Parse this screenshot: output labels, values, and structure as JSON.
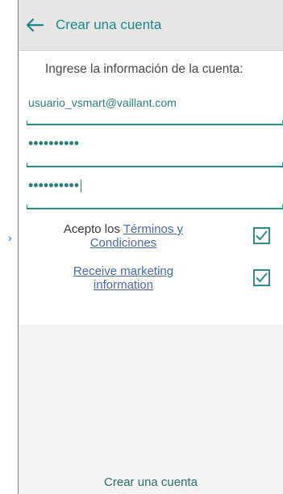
{
  "header": {
    "title": "Crear una cuenta"
  },
  "form": {
    "subtitle": "Ingrese la información de la cuenta:",
    "email_value": "usuario_vsmart@vaillant.com",
    "password_value": "••••••••••",
    "confirm_password_value": "••••••••••"
  },
  "terms": {
    "prefix": "Acepto los ",
    "link_line1": "Términos y",
    "link_line2": "Condiciones",
    "checked": true
  },
  "marketing": {
    "line1": "Receive marketing",
    "line2": "information",
    "checked": true
  },
  "footer": {
    "create_account_label": "Crear una cuenta"
  },
  "colors": {
    "accent": "#25938c",
    "link": "#4a6aa0",
    "header_bg": "#e6e6e6"
  },
  "icons": {
    "back": "arrow-left",
    "check": "checkmark"
  }
}
